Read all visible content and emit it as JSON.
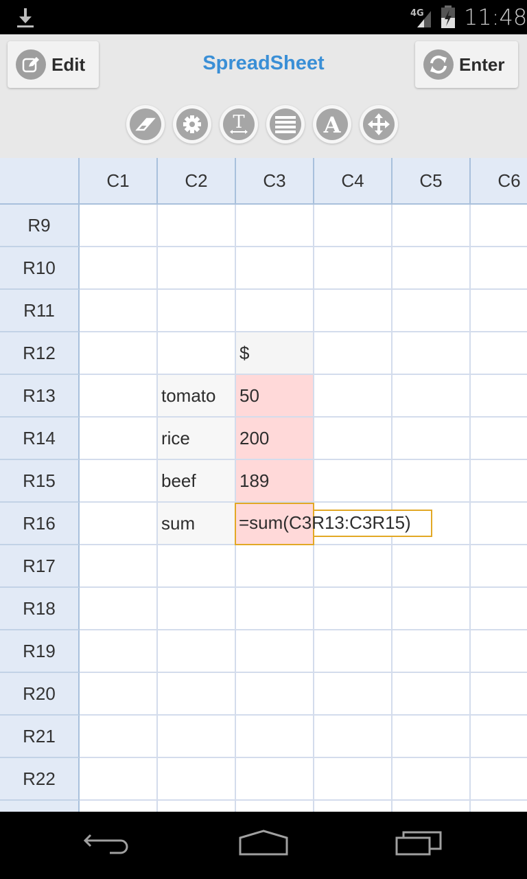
{
  "status_bar": {
    "time": "11:48",
    "network": "4G",
    "icons": [
      "download-icon",
      "signal-icon",
      "battery-charging-icon"
    ]
  },
  "header": {
    "title": "SpreadSheet",
    "edit_label": "Edit",
    "enter_label": "Enter",
    "title_color": "#3a8fd6"
  },
  "toolbar": {
    "tools": [
      {
        "name": "eraser-icon"
      },
      {
        "name": "gear-icon"
      },
      {
        "name": "text-width-icon"
      },
      {
        "name": "align-lines-icon"
      },
      {
        "name": "font-icon"
      },
      {
        "name": "move-icon"
      }
    ]
  },
  "sheet": {
    "columns": [
      "C1",
      "C2",
      "C3",
      "C4",
      "C5",
      "C6"
    ],
    "rows": [
      "R9",
      "R10",
      "R11",
      "R12",
      "R13",
      "R14",
      "R15",
      "R16",
      "R17",
      "R18",
      "R19",
      "R20",
      "R21",
      "R22"
    ],
    "cells": {
      "R12_C3": "$",
      "R13_C2": "tomato",
      "R13_C3": "50",
      "R14_C2": "rice",
      "R14_C3": "200",
      "R15_C2": "beef",
      "R15_C3": "189",
      "R16_C2": "sum",
      "R16_C3": "=sum(C3R13:C3R15)"
    },
    "selected_cell": "R16_C3",
    "highlight_color": "#ffd9d9",
    "selection_color": "#e2a825"
  },
  "nav_bar": {
    "buttons": [
      "back-icon",
      "home-icon",
      "recent-apps-icon"
    ]
  }
}
